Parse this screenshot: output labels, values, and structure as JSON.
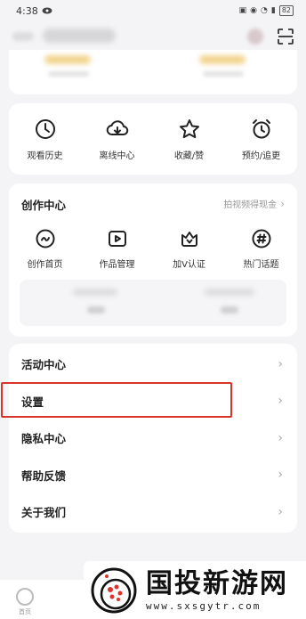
{
  "status_bar": {
    "time": "4:38",
    "battery": "82"
  },
  "quick_actions": [
    {
      "label": "观看历史",
      "icon": "clock-icon"
    },
    {
      "label": "离线中心",
      "icon": "cloud-download-icon"
    },
    {
      "label": "收藏/赞",
      "icon": "star-icon"
    },
    {
      "label": "预约/追更",
      "icon": "alarm-icon"
    }
  ],
  "creation": {
    "title": "创作中心",
    "link_text": "拍视频得现金",
    "items": [
      {
        "label": "创作首页",
        "icon": "creator-home-icon"
      },
      {
        "label": "作品管理",
        "icon": "video-manage-icon"
      },
      {
        "label": "加V认证",
        "icon": "verify-badge-icon"
      },
      {
        "label": "热门话题",
        "icon": "hashtag-icon"
      }
    ]
  },
  "menu": [
    {
      "label": "活动中心"
    },
    {
      "label": "设置"
    },
    {
      "label": "隐私中心"
    },
    {
      "label": "帮助反馈"
    },
    {
      "label": "关于我们"
    }
  ],
  "bottom_nav": {
    "home_label": "首页"
  },
  "watermark": {
    "title": "国投新游网",
    "url": "www.sxsgytr.com"
  },
  "colors": {
    "highlight": "#d9342b",
    "background": "#f4f4f6"
  }
}
